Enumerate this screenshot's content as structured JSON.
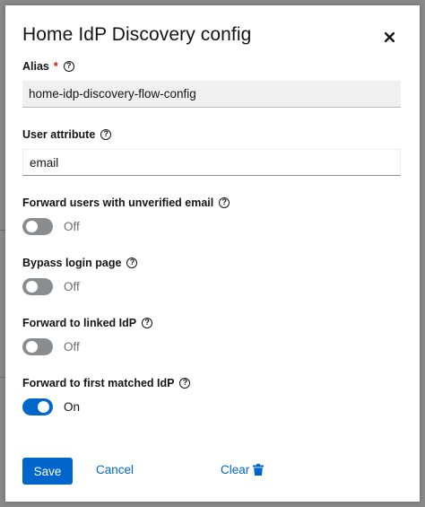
{
  "modal": {
    "title": "Home IdP Discovery config",
    "close_icon": "close-icon"
  },
  "fields": {
    "alias": {
      "label": "Alias",
      "required_mark": "*",
      "help_icon": "help-icon",
      "value": "home-idp-discovery-flow-config"
    },
    "user_attribute": {
      "label": "User attribute",
      "help_icon": "help-icon",
      "value": "email"
    }
  },
  "switches": [
    {
      "label": "Forward users with unverified email",
      "state_label": "Off",
      "on": false,
      "help_icon": "help-icon"
    },
    {
      "label": "Bypass login page",
      "state_label": "Off",
      "on": false,
      "help_icon": "help-icon"
    },
    {
      "label": "Forward to linked IdP",
      "state_label": "Off",
      "on": false,
      "help_icon": "help-icon"
    },
    {
      "label": "Forward to first matched IdP",
      "state_label": "On",
      "on": true,
      "help_icon": "help-icon"
    }
  ],
  "actions": {
    "save_label": "Save",
    "cancel_label": "Cancel",
    "clear_label": "Clear",
    "clear_icon": "trash-icon"
  },
  "colors": {
    "primary": "#0066cc",
    "required": "#c9190b",
    "switch_off": "#8a8d90"
  }
}
